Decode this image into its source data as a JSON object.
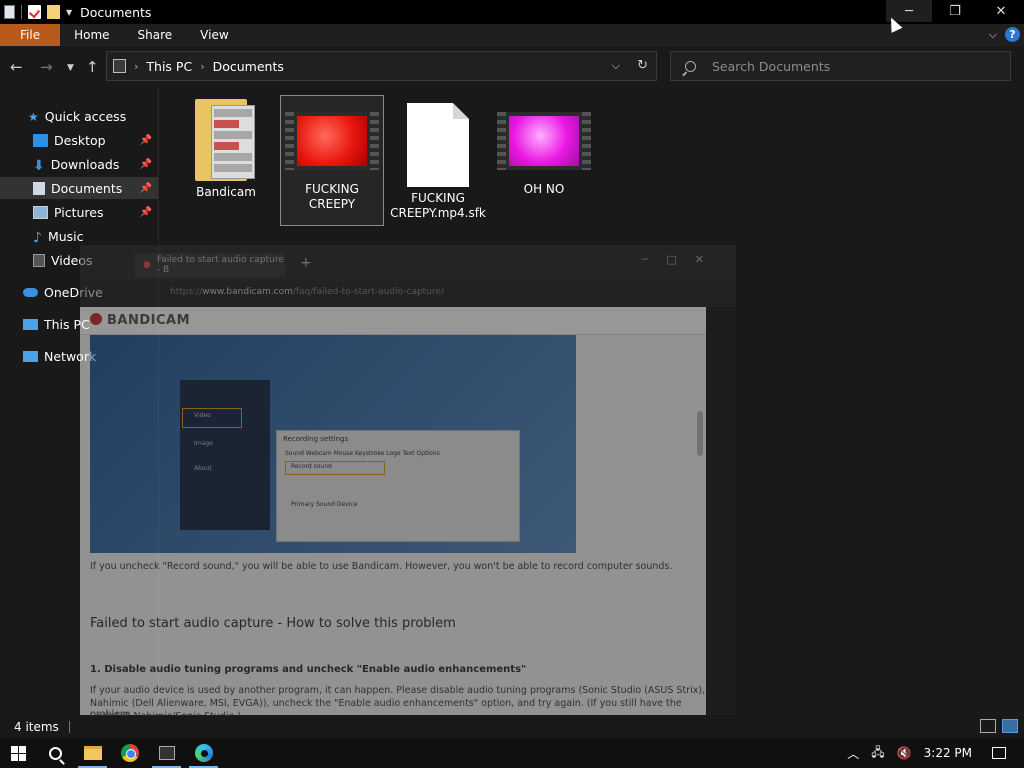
{
  "window": {
    "title": "Documents",
    "minimize_glyph": "─",
    "restore_glyph": "❐",
    "close_glyph": "✕"
  },
  "ribbon": {
    "tabs": [
      {
        "label": "File"
      },
      {
        "label": "Home"
      },
      {
        "label": "Share"
      },
      {
        "label": "View"
      }
    ],
    "help_glyph": "?"
  },
  "address": {
    "breadcrumbs": [
      "This PC",
      "Documents"
    ],
    "search_placeholder": "Search Documents"
  },
  "nav": {
    "items": [
      {
        "label": "Quick access",
        "icon": "star-icon",
        "color": "#4aa3ea"
      },
      {
        "label": "Desktop",
        "icon": "desktop-icon",
        "color": "#2f8fe0",
        "pinned": true
      },
      {
        "label": "Downloads",
        "icon": "download-icon",
        "color": "#3a8fe0",
        "pinned": true
      },
      {
        "label": "Documents",
        "icon": "document-icon",
        "color": "#cfd8e3",
        "pinned": true,
        "selected": true
      },
      {
        "label": "Pictures",
        "icon": "pictures-icon",
        "color": "#8ab4d8",
        "pinned": true
      },
      {
        "label": "Music",
        "icon": "music-icon",
        "color": "#4aa3ea"
      },
      {
        "label": "Videos",
        "icon": "videos-icon",
        "color": "#777"
      },
      {
        "label": "OneDrive",
        "icon": "cloud-icon",
        "color": "#3a8fe0"
      },
      {
        "label": "This PC",
        "icon": "computer-icon",
        "color": "#4aa3ea"
      },
      {
        "label": "Network",
        "icon": "network-icon",
        "color": "#4aa3ea"
      }
    ]
  },
  "files": [
    {
      "name": "Bandicam",
      "type": "folder"
    },
    {
      "name": "FUCKING CREEPY",
      "type": "video",
      "thumb_color": "#e8170e",
      "selected": true
    },
    {
      "name": "FUCKING CREEPY.mp4.sfk",
      "type": "document"
    },
    {
      "name": "OH NO",
      "type": "video",
      "thumb_color": "#ea17e4"
    }
  ],
  "ghost_browser": {
    "tab_title": "Failed to start audio capture - B",
    "url_host": "www.bandicam.com",
    "url_path": "/faq/failed-to-start-audio-capture/",
    "logo": "BANDICAM",
    "dialog_title": "Recording settings",
    "dialog_tabs": "Sound  Webcam  Mouse  Keystroke  Logo  Text  Options",
    "dialog_checkbox": "Record sound",
    "dialog_section": "Primary Sound Device",
    "panel_items": [
      "Video",
      "Image",
      "About"
    ],
    "uncheck_text": "If you uncheck \"Record sound,\" you will be able to use Bandicam. However, you won't be able to record computer sounds.",
    "heading": "Failed to start audio capture - How to solve this problem",
    "subheading": "1. Disable audio tuning programs and uncheck \"Enable audio enhancements\"",
    "para_1": "If your audio device is used by another program, it can happen. Please disable audio tuning programs (Sonic Studio (ASUS Strix),",
    "para_2": "Nahimic (Dell Alienware, MSI, EVGA)), uncheck the \"Enable audio enhancements\" option, and try again. (If you still have the problem,",
    "para_3": "uninstall Nahimic/Sonic Studio.)"
  },
  "status": {
    "item_count": "4 items"
  },
  "taskbar": {
    "time": "3:22 PM",
    "apps": [
      "windows-start",
      "search",
      "file-explorer",
      "chrome",
      "bandicam",
      "edge"
    ]
  }
}
